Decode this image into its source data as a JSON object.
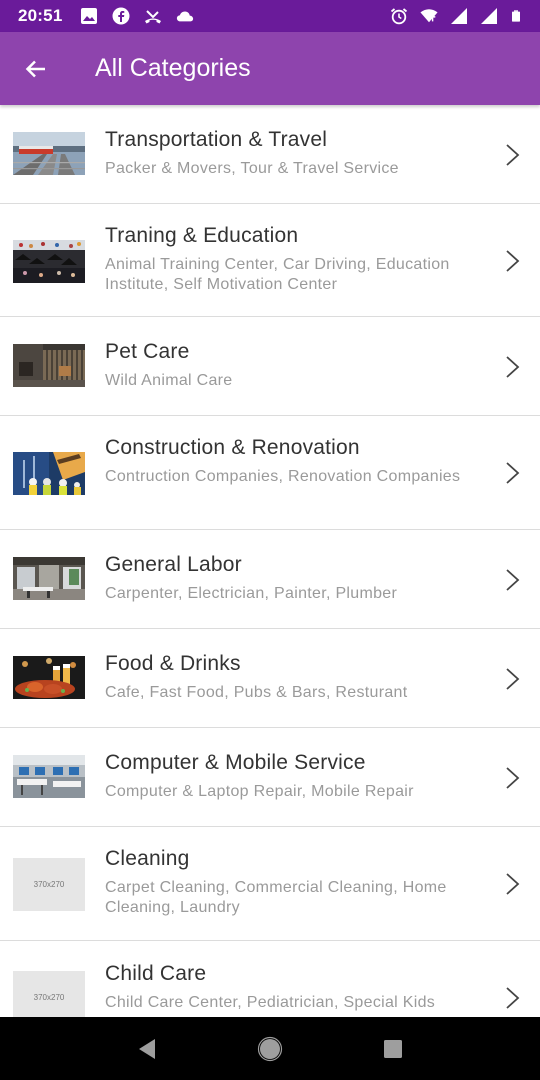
{
  "status_bar": {
    "time": "20:51",
    "left_icons": [
      "image-icon",
      "facebook-icon",
      "missed-call-icon",
      "cloud-icon"
    ],
    "right_icons": [
      "alarm-icon",
      "wifi-icon",
      "signal-icon",
      "signal-icon",
      "battery-icon"
    ]
  },
  "app_bar": {
    "title": "All Categories",
    "back_icon": "arrow-back-icon"
  },
  "categories": [
    {
      "title": "Transportation & Travel",
      "subtitle": "Packer & Movers, Tour & Travel Service",
      "image": "photo"
    },
    {
      "title": "Traning & Education",
      "subtitle": "Animal Training Center, Car Driving, Education Institute, Self Motivation Center",
      "image": "photo"
    },
    {
      "title": "Pet Care",
      "subtitle": "Wild Animal Care",
      "image": "photo"
    },
    {
      "title": "Construction & Renovation",
      "subtitle": "Contruction Companies, Renovation Companies",
      "image": "photo"
    },
    {
      "title": "General Labor",
      "subtitle": "Carpenter, Electrician, Painter, Plumber",
      "image": "photo"
    },
    {
      "title": "Food & Drinks",
      "subtitle": "Cafe, Fast Food, Pubs & Bars, Resturant",
      "image": "photo"
    },
    {
      "title": "Computer & Mobile Service",
      "subtitle": "Computer & Laptop Repair, Mobile Repair",
      "image": "photo"
    },
    {
      "title": "Cleaning",
      "subtitle": "Carpet Cleaning, Commercial Cleaning, Home Cleaning, Laundry",
      "image": "placeholder",
      "placeholder_text": "370x270"
    },
    {
      "title": "Child Care",
      "subtitle": "Child Care Center, Pediatrician, Special Kids",
      "image": "placeholder",
      "placeholder_text": "370x270"
    }
  ],
  "nav_bar": {
    "back": "nav-back-icon",
    "home": "nav-home-icon",
    "recents": "nav-recents-icon"
  },
  "colors": {
    "status_bar": "#6a1b9a",
    "app_bar": "#8e44ad",
    "title_text": "#333333",
    "subtitle_text": "#9a9a9a"
  }
}
